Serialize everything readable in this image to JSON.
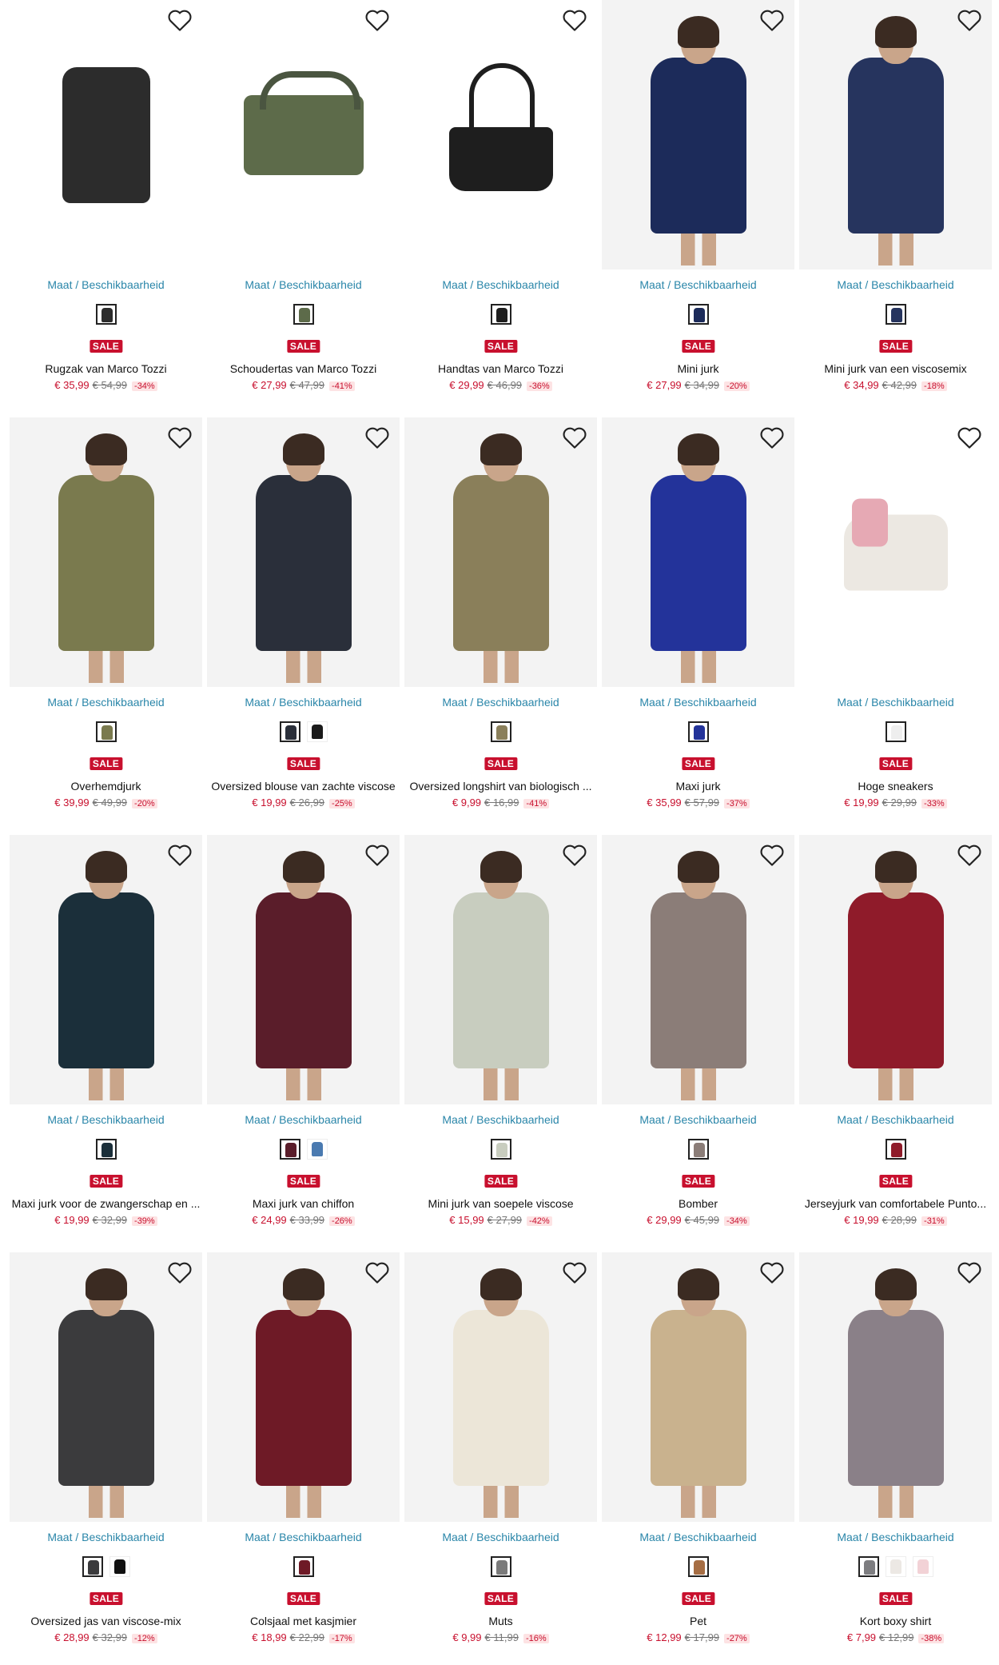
{
  "common": {
    "size_link": "Maat / Beschikbaarheid",
    "sale_badge": "SALE"
  },
  "products": [
    {
      "name": "Rugzak van Marco Tozzi",
      "price": "€ 35,99",
      "was": "€ 54,99",
      "discount": "-34%",
      "kind": "backpack",
      "color": "#2c2c2c",
      "swatches": [
        "#2c2c2c"
      ]
    },
    {
      "name": "Schoudertas van Marco Tozzi",
      "price": "€ 27,99",
      "was": "€ 47,99",
      "discount": "-41%",
      "kind": "crossbody",
      "color": "#5d6b4a",
      "swatches": [
        "#5d6b4a"
      ]
    },
    {
      "name": "Handtas van Marco Tozzi",
      "price": "€ 29,99",
      "was": "€ 46,99",
      "discount": "-36%",
      "kind": "handbag",
      "color": "#1e1e1e",
      "swatches": [
        "#1e1e1e"
      ]
    },
    {
      "name": "Mini jurk",
      "price": "€ 27,99",
      "was": "€ 34,99",
      "discount": "-20%",
      "kind": "dress",
      "color": "#1c2b5a",
      "swatches": [
        "#1c2b5a"
      ]
    },
    {
      "name": "Mini jurk van een viscosemix",
      "price": "€ 34,99",
      "was": "€ 42,99",
      "discount": "-18%",
      "kind": "dress",
      "color": "#26345e",
      "swatches": [
        "#26345e"
      ]
    },
    {
      "name": "Overhemdjurk",
      "price": "€ 39,99",
      "was": "€ 49,99",
      "discount": "-20%",
      "kind": "dress",
      "color": "#7a7a4e",
      "swatches": [
        "#7a7a4e"
      ]
    },
    {
      "name": "Oversized blouse van zachte viscose",
      "price": "€ 19,99",
      "was": "€ 26,99",
      "discount": "-25%",
      "kind": "dress",
      "color": "#2a2f3a",
      "swatches": [
        "#2a2f3a",
        "#1a1a1a"
      ]
    },
    {
      "name": "Oversized longshirt van biologisch ...",
      "price": "€ 9,99",
      "was": "€ 16,99",
      "discount": "-41%",
      "kind": "dress",
      "color": "#8a7f5a",
      "swatches": [
        "#8a7f5a"
      ]
    },
    {
      "name": "Maxi jurk",
      "price": "€ 35,99",
      "was": "€ 57,99",
      "discount": "-37%",
      "kind": "dress",
      "color": "#23339a",
      "swatches": [
        "#23339a"
      ]
    },
    {
      "name": "Hoge sneakers",
      "price": "€ 19,99",
      "was": "€ 29,99",
      "discount": "-33%",
      "kind": "sneaker",
      "color": "#e6a9b4",
      "swatches": [
        "#eeeeee"
      ]
    },
    {
      "name": "Maxi jurk voor de zwangerschap en ...",
      "price": "€ 19,99",
      "was": "€ 32,99",
      "discount": "-39%",
      "kind": "dress",
      "color": "#1b2f3a",
      "swatches": [
        "#1b2f3a"
      ]
    },
    {
      "name": "Maxi jurk van chiffon",
      "price": "€ 24,99",
      "was": "€ 33,99",
      "discount": "-26%",
      "kind": "dress",
      "color": "#5a1d2a",
      "swatches": [
        "#5a1d2a",
        "#4a7ab0"
      ]
    },
    {
      "name": "Mini jurk van soepele viscose",
      "price": "€ 15,99",
      "was": "€ 27,99",
      "discount": "-42%",
      "kind": "dress",
      "color": "#c8cdbf",
      "swatches": [
        "#c8cdbf"
      ]
    },
    {
      "name": "Bomber",
      "price": "€ 29,99",
      "was": "€ 45,99",
      "discount": "-34%",
      "kind": "dress",
      "color": "#8b7d78",
      "swatches": [
        "#8b7d78"
      ]
    },
    {
      "name": "Jerseyjurk van comfortabele Punto...",
      "price": "€ 19,99",
      "was": "€ 28,99",
      "discount": "-31%",
      "kind": "dress",
      "color": "#8f1b2a",
      "swatches": [
        "#8f1b2a"
      ]
    },
    {
      "name": "Oversized jas van viscose-mix",
      "price": "€ 28,99",
      "was": "€ 32,99",
      "discount": "-12%",
      "kind": "dress",
      "color": "#3b3b3d",
      "swatches": [
        "#3b3b3d",
        "#111111"
      ]
    },
    {
      "name": "Colsjaal met kasjmier",
      "price": "€ 18,99",
      "was": "€ 22,99",
      "discount": "-17%",
      "kind": "dress",
      "color": "#6e1a26",
      "swatches": [
        "#6e1a26"
      ]
    },
    {
      "name": "Muts",
      "price": "€ 9,99",
      "was": "€ 11,99",
      "discount": "-16%",
      "kind": "dress",
      "color": "#ece6d8",
      "swatches": [
        "#7a7a7a"
      ]
    },
    {
      "name": "Pet",
      "price": "€ 12,99",
      "was": "€ 17,99",
      "discount": "-27%",
      "kind": "dress",
      "color": "#c9b28e",
      "swatches": [
        "#a66e44"
      ]
    },
    {
      "name": "Kort boxy shirt",
      "price": "€ 7,99",
      "was": "€ 12,99",
      "discount": "-38%",
      "kind": "dress",
      "color": "#8a8088",
      "swatches": [
        "#7d7d80",
        "#ece8e4",
        "#f2d2d6"
      ]
    }
  ]
}
